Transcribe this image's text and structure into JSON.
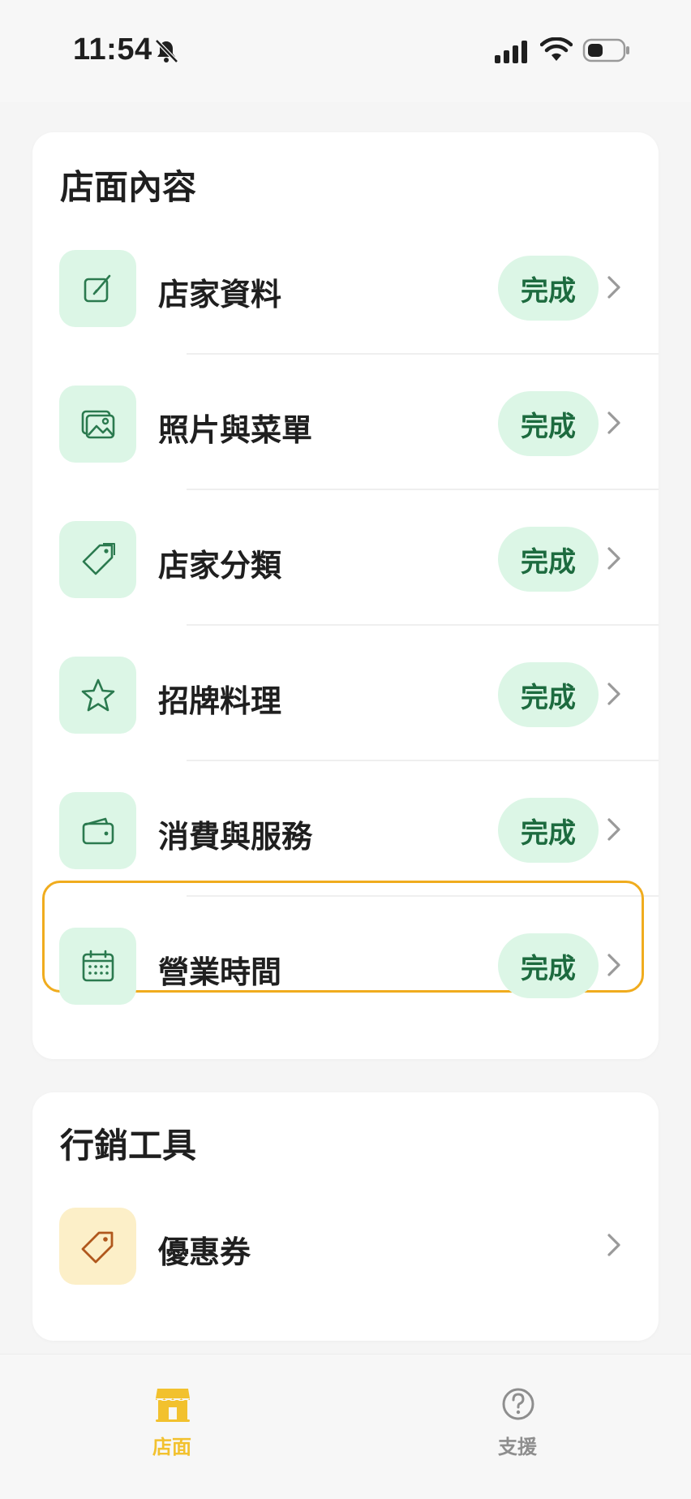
{
  "status_bar": {
    "time": "11:54"
  },
  "store_section": {
    "title": "店面內容",
    "items": [
      {
        "label": "店家資料",
        "status": "完成",
        "icon": "edit-icon"
      },
      {
        "label": "照片與菜單",
        "status": "完成",
        "icon": "photo-icon"
      },
      {
        "label": "店家分類",
        "status": "完成",
        "icon": "tag-icon"
      },
      {
        "label": "招牌料理",
        "status": "完成",
        "icon": "star-icon"
      },
      {
        "label": "消費與服務",
        "status": "完成",
        "icon": "wallet-icon"
      },
      {
        "label": "營業時間",
        "status": "完成",
        "icon": "calendar-icon"
      }
    ]
  },
  "marketing_section": {
    "title": "行銷工具",
    "items": [
      {
        "label": "優惠券",
        "icon": "coupon-icon"
      }
    ]
  },
  "tabbar": {
    "tabs": [
      {
        "label": "店面",
        "icon": "store-icon",
        "active": true
      },
      {
        "label": "支援",
        "icon": "help-icon",
        "active": false
      }
    ]
  },
  "colors": {
    "accent_green": "#1d6b3f",
    "tile_green": "#dcf6e6",
    "highlight_orange": "#f0ac1e",
    "active_tab": "#f2c12e"
  }
}
